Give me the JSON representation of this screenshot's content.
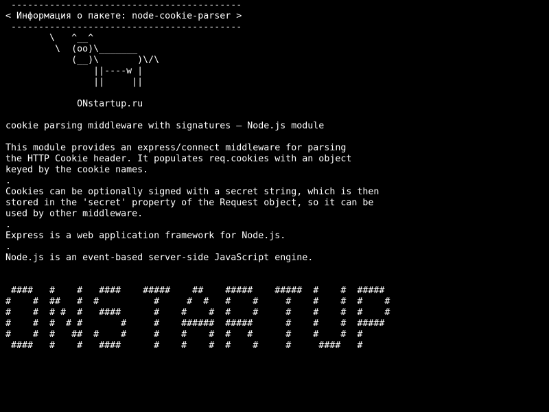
{
  "terminal": {
    "bubble": {
      "top_border": " ------------------------------------------",
      "text": "< Информация о пакете: node-cookie-parser >",
      "bottom_border": " ------------------------------------------"
    },
    "cow": [
      "        \\   ^__^",
      "         \\  (oo)\\_______",
      "            (__)\\       )\\/\\",
      "                ||----w |",
      "                ||     ||"
    ],
    "site_label": "             ONstartup.ru",
    "summary": "cookie parsing middleware with signatures – Node.js module",
    "description": [
      "This module provides an express/connect middleware for parsing",
      "the HTTP Cookie header. It populates req.cookies with an object",
      "keyed by the cookie names.",
      ".",
      "Cookies can be optionally signed with a secret string, which is then",
      "stored in the 'secret' property of the Request object, so it can be",
      "used by other middleware.",
      ".",
      "Express is a web application framework for Node.js.",
      ".",
      "Node.js is an event-based server-side JavaScript engine."
    ],
    "banner": [
      " ####   #    #   ####    #####    ##    #####    #####  #    #  #####",
      "#    #  ##   #  #          #     #  #   #    #     #    #    #  #    #",
      "#    #  # #  #   ####      #    #    #  #    #     #    #    #  #    #",
      "#    #  #  # #       #     #    ######  #####      #    #    #  #####",
      "#    #  #   ##  #    #     #    #    #  #   #      #    #    #  #",
      " ####   #    #   ####      #    #    #  #    #     #     ####   #"
    ]
  }
}
